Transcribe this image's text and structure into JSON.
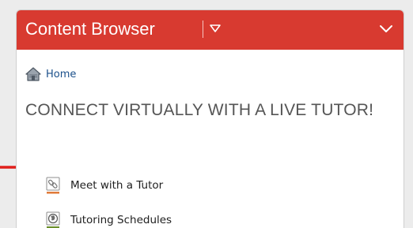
{
  "panel": {
    "title": "Content Browser",
    "header_color": "#d83a30",
    "title_dropdown_icon": "triangle-down-icon",
    "collapse_icon": "chevron-down-icon"
  },
  "breadcrumb": {
    "icon": "home-icon",
    "label": "Home"
  },
  "module": {
    "heading": "CONNECT VIRTUALLY WITH A LIVE TUTOR!"
  },
  "items": [
    {
      "label": "Meet with a Tutor",
      "icon": "link-icon",
      "icon_underline_color": "#e07b39"
    },
    {
      "label": "Tutoring Schedules",
      "icon": "globe-icon",
      "icon_underline_color": "#6a8f2a"
    }
  ],
  "annotation": {
    "arrow_color": "#e0201c",
    "points_to": "Meet with a Tutor"
  }
}
